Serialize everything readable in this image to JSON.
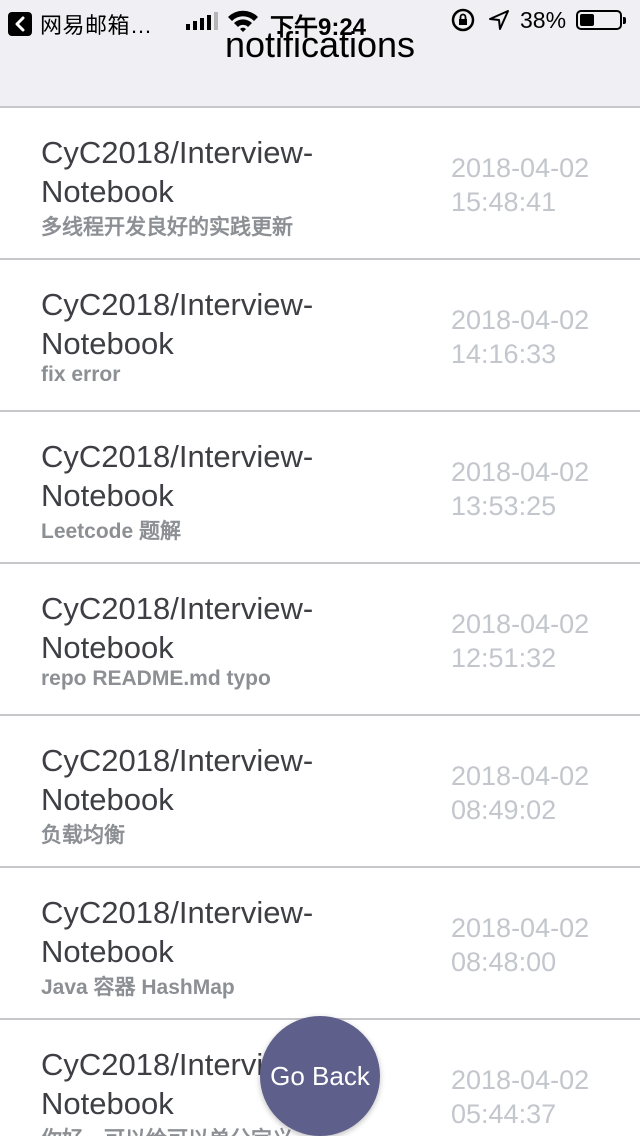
{
  "status_bar": {
    "back_app_label": "网易邮箱…",
    "time": "下午9:24",
    "battery": "38%",
    "battery_level": 0.38
  },
  "header": {
    "title": "notifications"
  },
  "notifications": [
    {
      "repo": "CyC2018/Interview-Notebook",
      "message": "多线程开发良好的实践更新",
      "date": "2018-04-02",
      "time": "15:48:41"
    },
    {
      "repo": "CyC2018/Interview-Notebook",
      "message": "fix error",
      "date": "2018-04-02",
      "time": "14:16:33"
    },
    {
      "repo": "CyC2018/Interview-Notebook",
      "message": "Leetcode 题解",
      "date": "2018-04-02",
      "time": "13:53:25"
    },
    {
      "repo": "CyC2018/Interview-Notebook",
      "message": "repo README.md typo",
      "date": "2018-04-02",
      "time": "12:51:32"
    },
    {
      "repo": "CyC2018/Interview-Notebook",
      "message": "负载均衡",
      "date": "2018-04-02",
      "time": "08:49:02"
    },
    {
      "repo": "CyC2018/Interview-Notebook",
      "message": "Java 容器 HashMap",
      "date": "2018-04-02",
      "time": "08:48:00"
    },
    {
      "repo": "CyC2018/Interview-Notebook",
      "message": "你好，可以给可以单分定义",
      "date": "2018-04-02",
      "time": "05:44:37"
    }
  ],
  "go_back_button": {
    "label": "Go Back",
    "color": "#5e5f8b"
  },
  "colors": {
    "header_bg": "#efeff4",
    "repo_text": "#3e3f44",
    "message_text": "#8c8f94",
    "time_text": "#c3c6cc"
  }
}
